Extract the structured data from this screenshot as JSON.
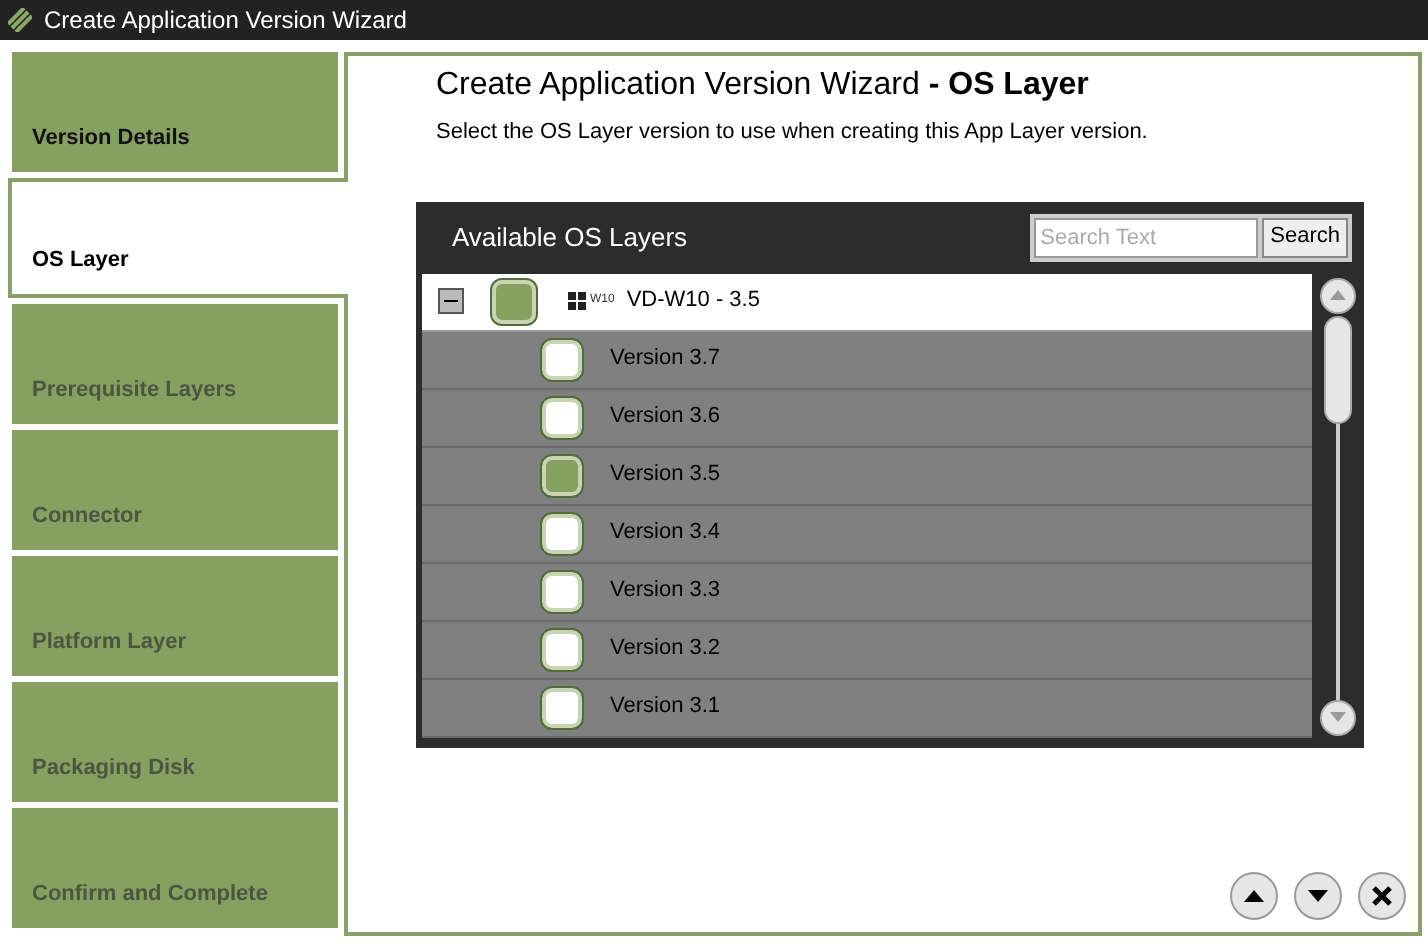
{
  "window": {
    "title": "Create Application Version Wizard"
  },
  "steps": [
    {
      "label": "Version Details",
      "selected": false,
      "disabled": false
    },
    {
      "label": "OS Layer",
      "selected": true,
      "disabled": false
    },
    {
      "label": "Prerequisite Layers",
      "selected": false,
      "disabled": true
    },
    {
      "label": "Connector",
      "selected": false,
      "disabled": true
    },
    {
      "label": "Platform Layer",
      "selected": false,
      "disabled": true
    },
    {
      "label": "Packaging Disk",
      "selected": false,
      "disabled": true
    },
    {
      "label": "Confirm and Complete",
      "selected": false,
      "disabled": true
    }
  ],
  "heading": "Create Application Version Wizard **- OS Layer**",
  "instructions": "Select the OS Layer version to use when creating this App Layer version.",
  "panel": {
    "title": "Available OS Layers",
    "search": {
      "placeholder": "Search Text",
      "button": "Search"
    },
    "tree": [
      {
        "label": "VD-W10 - 3.5",
        "badge": "W10",
        "expanded": true,
        "checked": true,
        "children": [
          {
            "label": "Version 3.7",
            "checked": false
          },
          {
            "label": "Version 3.6",
            "checked": false
          },
          {
            "label": "Version 3.5",
            "checked": true
          },
          {
            "label": "Version 3.4",
            "checked": false
          },
          {
            "label": "Version 3.3",
            "checked": false
          },
          {
            "label": "Version 3.2",
            "checked": false
          },
          {
            "label": "Version 3.1",
            "checked": false
          }
        ]
      }
    ]
  },
  "nav_buttons": [
    {
      "kind": "up"
    },
    {
      "kind": "down"
    },
    {
      "kind": "close"
    }
  ]
}
